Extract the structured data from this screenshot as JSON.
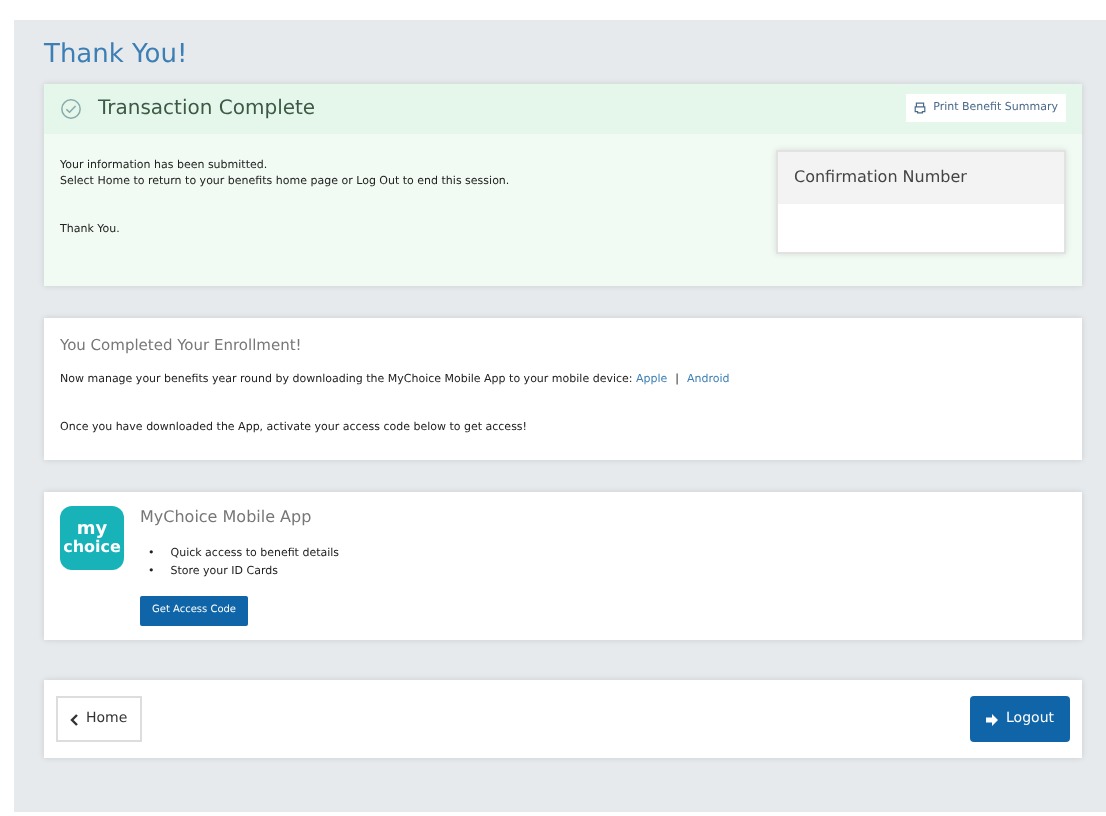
{
  "page_title": "Thank You!",
  "transaction": {
    "title": "Transaction Complete",
    "print_link": "Print Benefit Summary",
    "lines": [
      "Your information has been submitted.",
      "Select Home to return to your benefits home page or Log Out to end this session."
    ],
    "closing": "Thank You.",
    "confirmation": {
      "label": "Confirmation Number"
    }
  },
  "enrollment": {
    "title": "You Completed Your Enrollment!",
    "text": "Now manage your benefits year round by downloading the MyChoice Mobile App to your mobile device:",
    "links": [
      "Apple",
      "Android"
    ],
    "separator": "|",
    "note": "Once you have downloaded the App, activate your access code below to get access!"
  },
  "app": {
    "logo": [
      "my",
      "choice"
    ],
    "title": "MyChoice Mobile App",
    "bullet": "•",
    "features": [
      "Quick access to benefit details",
      "Store your ID Cards"
    ],
    "button": "Get Access Code"
  },
  "footer": {
    "home": "Home",
    "logout": "Logout"
  }
}
